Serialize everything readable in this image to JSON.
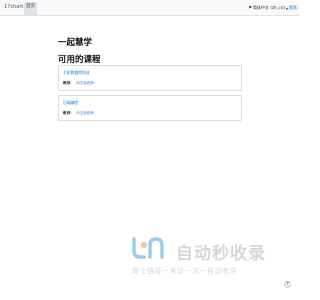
{
  "navbar": {
    "brand": "17chart",
    "home_link": "首页",
    "language": {
      "label": "简体中文 (zh_cn)",
      "icon": "language-icon",
      "caret": "▾"
    },
    "login": "登陆"
  },
  "site": {
    "title": "一起慧学"
  },
  "courses": {
    "section_title": "可用的课程",
    "teacher_label": "教师：",
    "items": [
      {
        "title": "七彩数据库科技",
        "teacher": "卢应亚老师"
      },
      {
        "title": "后端编程",
        "teacher": "卢应亚老师"
      }
    ]
  },
  "watermark": {
    "text": "自动秒收录",
    "slogan": "做上链接一来访一次一自动收录",
    "colors": {
      "logo_blue": "#9ecbec",
      "logo_orange": "#f6c28c",
      "text": "#d4d7dc"
    }
  },
  "help": {
    "label": "?"
  },
  "colors": {
    "link": "#1a73e8",
    "navbar_bg": "#f8f9fa"
  }
}
